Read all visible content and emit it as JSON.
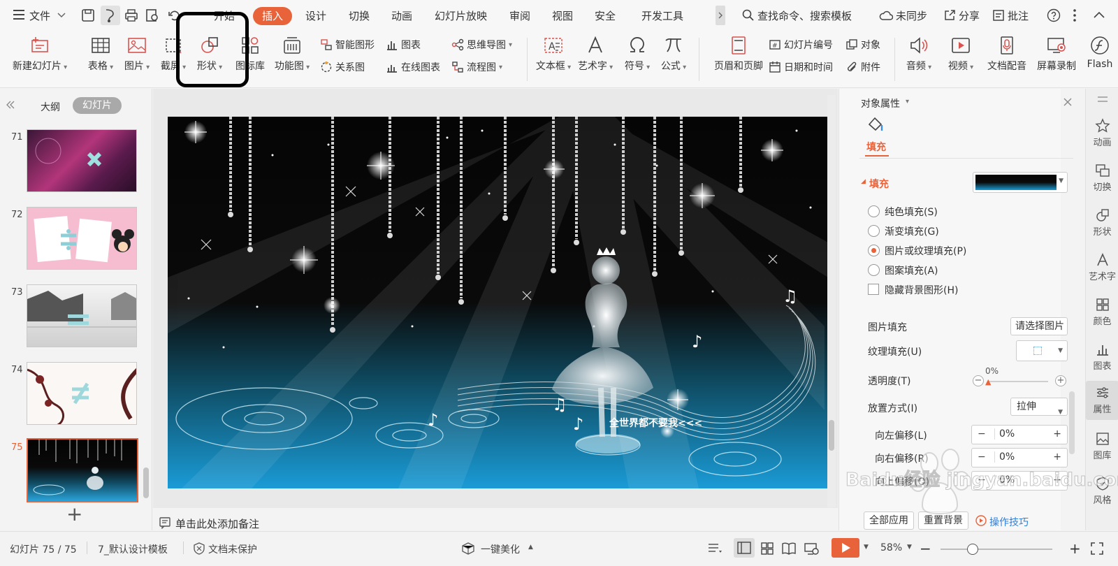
{
  "menubar": {
    "file_label": "文件",
    "tabs": [
      "开始",
      "插入",
      "设计",
      "切换",
      "动画",
      "幻灯片放映",
      "审阅",
      "视图",
      "安全",
      "开发工具"
    ],
    "search_placeholder": "查找命令、搜索模板",
    "sync_label": "未同步",
    "share_label": "分享",
    "comment_label": "批注"
  },
  "ribbon": {
    "new_slide": "新建幻灯片",
    "table": "表格",
    "picture": "图片",
    "screenshot": "截屏",
    "shape": "形状",
    "icon_lib": "图标库",
    "function_chart": "功能图",
    "smart_graphic": "智能图形",
    "chart": "图表",
    "relation_chart": "关系图",
    "online_chart": "在线图表",
    "mind_map": "思维导图",
    "flowchart": "流程图",
    "textbox": "文本框",
    "wordart": "艺术字",
    "symbol": "符号",
    "formula": "公式",
    "header_footer": "页眉和页脚",
    "slide_number": "幻灯片编号",
    "object": "对象",
    "datetime": "日期和时间",
    "attachment": "附件",
    "audio": "音频",
    "video": "视频",
    "doc_voice": "文档配音",
    "screen_record": "屏幕录制",
    "flash": "Flash"
  },
  "leftpanel": {
    "tab_outline": "大纲",
    "tab_slides": "幻灯片",
    "thumbnails": [
      "71",
      "72",
      "73",
      "74",
      "75"
    ],
    "add_symbol": "+"
  },
  "slide": {
    "caption": "全世界都不要我<<<"
  },
  "notes_placeholder": "单击此处添加备注",
  "properties": {
    "title": "对象属性",
    "tab_fill": "填充",
    "section_fill": "填充",
    "options": [
      "纯色填充(S)",
      "渐变填充(G)",
      "图片或纹理填充(P)",
      "图案填充(A)"
    ],
    "selected_option": 2,
    "hide_bg_label": "隐藏背景图形(H)",
    "picture_fill_label": "图片填充",
    "picture_fill_button": "请选择图片",
    "texture_fill_label": "纹理填充(U)",
    "transparency_label": "透明度(T)",
    "transparency_value": "0%",
    "placement_label": "放置方式(I)",
    "placement_value": "拉伸",
    "offset_left_label": "向左偏移(L)",
    "offset_left_value": "0%",
    "offset_right_label": "向右偏移(R)",
    "offset_right_value": "0%",
    "offset_up_label": "向上偏移(O)",
    "offset_up_value": "0%",
    "apply_all": "全部应用",
    "reset_bg": "重置背景",
    "tips": "操作技巧"
  },
  "rightbar": [
    "动画",
    "切换",
    "形状",
    "艺术字",
    "颜色",
    "图表",
    "属性",
    "图库",
    "风格"
  ],
  "statusbar": {
    "slide_count": "幻灯片 75 / 75",
    "template": "7_默认设计模板",
    "protection": "文档未保护",
    "beautify": "一键美化",
    "zoom": "58%"
  },
  "watermark": "Baidu经验 jingyan.baidu.com",
  "colors": {
    "accent": "#e8623a",
    "highlight_box": "#000000",
    "link": "#2f7fd8"
  }
}
